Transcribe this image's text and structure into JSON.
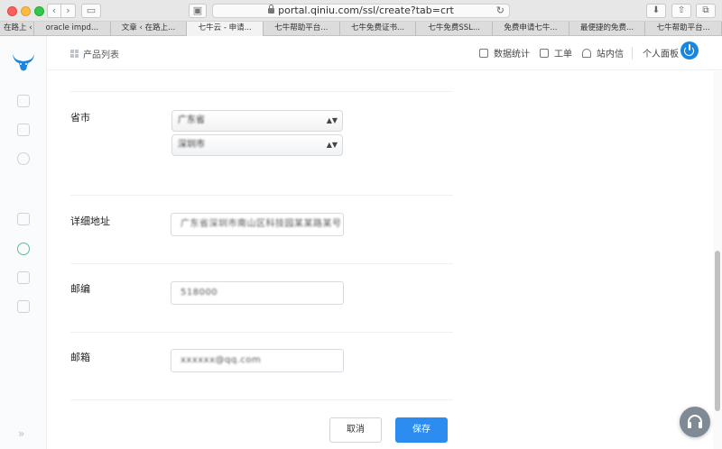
{
  "browser": {
    "url": "portal.qiniu.com/ssl/create?tab=crt",
    "tabs": [
      {
        "label": "在路上 ‹",
        "active": false
      },
      {
        "label": "oracle impd...",
        "active": false
      },
      {
        "label": "文章 ‹ 在路上...",
        "active": false
      },
      {
        "label": "七牛云 - 申请...",
        "active": true
      },
      {
        "label": "七牛帮助平台...",
        "active": false
      },
      {
        "label": "七牛免费证书...",
        "active": false
      },
      {
        "label": "七牛免费SSL...",
        "active": false
      },
      {
        "label": "免费申请七牛...",
        "active": false
      },
      {
        "label": "最便捷的免费...",
        "active": false
      },
      {
        "label": "七牛帮助平台...",
        "active": false
      }
    ]
  },
  "header": {
    "products": "产品列表",
    "stats": "数据统计",
    "ticket": "工单",
    "messages": "站内信",
    "panel": "个人面板"
  },
  "form": {
    "province_city": {
      "label": "省市",
      "province_value": "广东省",
      "city_value": "深圳市"
    },
    "address": {
      "label": "详细地址",
      "value": "广东省深圳市南山区科技园某某路某号"
    },
    "postcode": {
      "label": "邮编",
      "value": "518000"
    },
    "email": {
      "label": "邮箱",
      "value": "xxxxxx@qq.com"
    },
    "cancel_label": "取消",
    "save_label": "保存"
  },
  "colors": {
    "primary": "#2d8cf0",
    "brand": "#1a86e0",
    "help": "#7f8a95"
  }
}
